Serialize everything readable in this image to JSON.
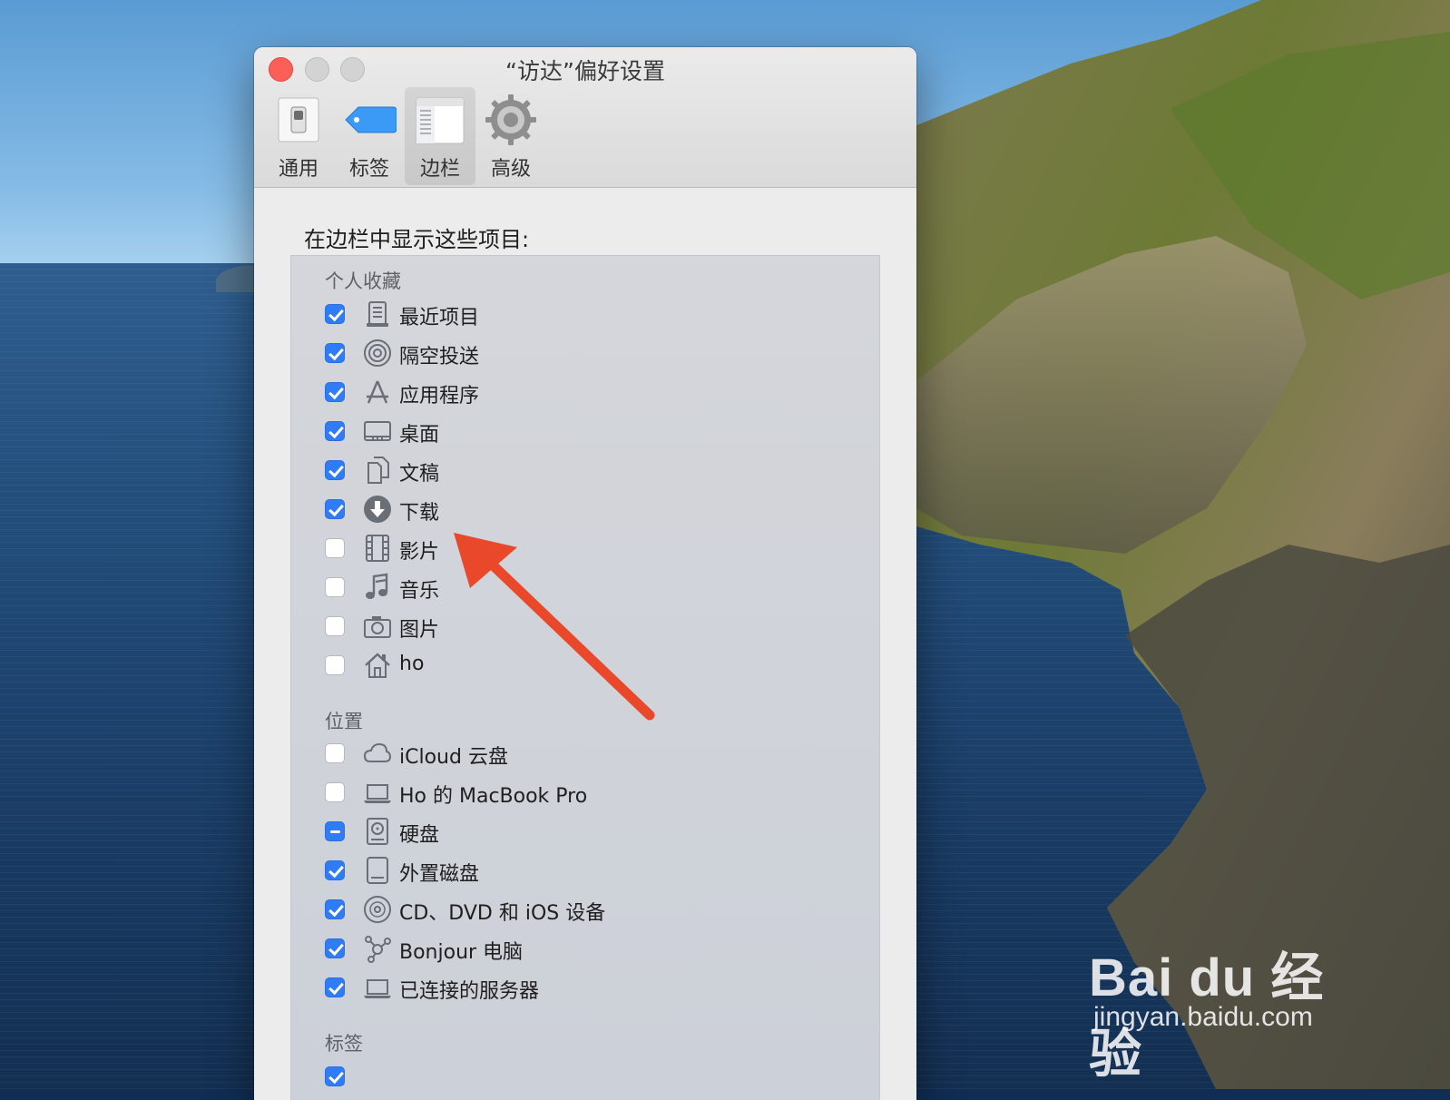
{
  "window": {
    "title": "“访达”偏好设置",
    "toolbar": [
      {
        "label": "通用",
        "icon": "switch-icon"
      },
      {
        "label": "标签",
        "icon": "tag-icon"
      },
      {
        "label": "边栏",
        "icon": "sidebar-icon",
        "selected": true
      },
      {
        "label": "高级",
        "icon": "gear-icon"
      }
    ]
  },
  "content": {
    "heading": "在边栏中显示这些项目:",
    "groups": {
      "favorites": {
        "label": "个人收藏",
        "items": [
          {
            "label": "最近项目",
            "icon": "recents-icon",
            "state": "on"
          },
          {
            "label": "隔空投送",
            "icon": "airdrop-icon",
            "state": "on"
          },
          {
            "label": "应用程序",
            "icon": "applications-icon",
            "state": "on"
          },
          {
            "label": "桌面",
            "icon": "desktop-icon",
            "state": "on"
          },
          {
            "label": "文稿",
            "icon": "documents-icon",
            "state": "on"
          },
          {
            "label": "下载",
            "icon": "downloads-icon",
            "state": "on"
          },
          {
            "label": "影片",
            "icon": "movies-icon",
            "state": "off"
          },
          {
            "label": "音乐",
            "icon": "music-icon",
            "state": "off"
          },
          {
            "label": "图片",
            "icon": "camera-icon",
            "state": "off"
          },
          {
            "label": "ho",
            "icon": "home-icon",
            "state": "off"
          }
        ]
      },
      "locations": {
        "label": "位置",
        "items": [
          {
            "label": "iCloud 云盘",
            "icon": "cloud-icon",
            "state": "off"
          },
          {
            "label": "Ho 的 MacBook Pro",
            "icon": "laptop-icon",
            "state": "off"
          },
          {
            "label": "硬盘",
            "icon": "hard-disk-icon",
            "state": "mixed"
          },
          {
            "label": "外置磁盘",
            "icon": "external-disk-icon",
            "state": "on"
          },
          {
            "label": "CD、DVD 和 iOS 设备",
            "icon": "disc-icon",
            "state": "on"
          },
          {
            "label": "Bonjour 电脑",
            "icon": "bonjour-icon",
            "state": "on"
          },
          {
            "label": "已连接的服务器",
            "icon": "server-icon",
            "state": "on"
          }
        ]
      },
      "tags": {
        "label": "标签"
      }
    }
  },
  "watermark": {
    "brand": "Bai du 经验",
    "url": "jingyan.baidu.com"
  },
  "colors": {
    "accent": "#2f7cf6",
    "annotation_arrow": "#e9492a"
  }
}
